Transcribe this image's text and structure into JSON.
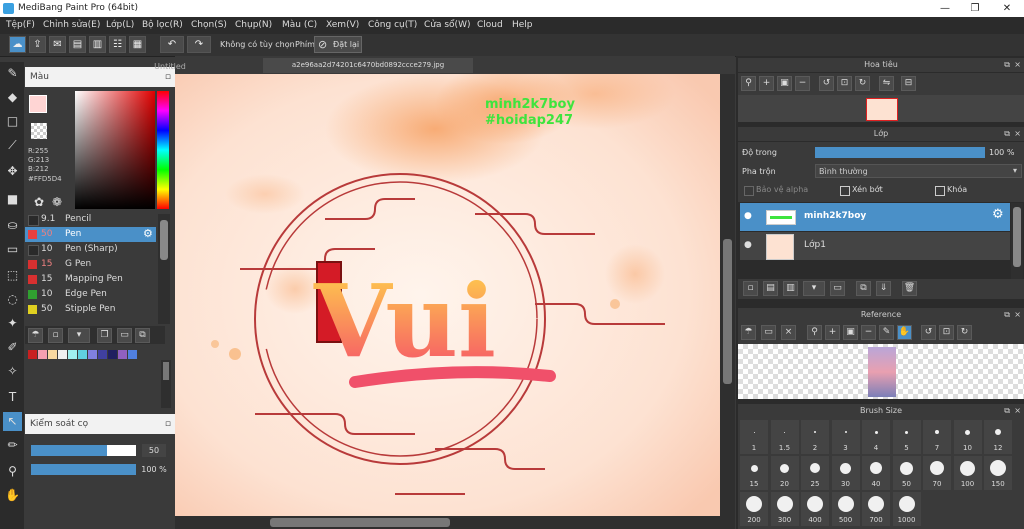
{
  "window": {
    "title": "MediBang Paint Pro (64bit)"
  },
  "menu": [
    "Tệp(F)",
    "Chỉnh sửa(E)",
    "Lớp(L)",
    "Bộ lọc(R)",
    "Chọn(S)",
    "Chụp(N)",
    "Màu (C)",
    "Xem(V)",
    "Công cụ(T)",
    "Cửa sổ(W)",
    "Cloud",
    "Help"
  ],
  "toolbar": {
    "no_option": "Không có tùy chọn",
    "key_label": "Phím",
    "reset_label": "Đặt lại"
  },
  "document": {
    "tab_untitled": "Untitled",
    "tab_active": "a2e96aa2d74201c6470bd0892ccce279.jpg"
  },
  "color_panel": {
    "title": "Màu",
    "r": "R:255",
    "g": "G:213",
    "b": "B:212",
    "hex": "#FFD5D4"
  },
  "brushes": [
    {
      "size": "9.1",
      "name": "Pencil",
      "color": "#2a2a2a"
    },
    {
      "size": "50",
      "name": "Pen",
      "color": "#e84040",
      "selected": true
    },
    {
      "size": "10",
      "name": "Pen (Sharp)",
      "color": "#2a2a2a"
    },
    {
      "size": "15",
      "name": "G Pen",
      "color": "#d83030"
    },
    {
      "size": "15",
      "name": "Mapping Pen",
      "color": "#d83030"
    },
    {
      "size": "10",
      "name": "Edge Pen",
      "color": "#30a030"
    },
    {
      "size": "50",
      "name": "Stipple Pen",
      "color": "#e0d020"
    }
  ],
  "palette": [
    "#c82020",
    "#f4a0b0",
    "#f8d8a0",
    "#f0f0f0",
    "#a0f0f0",
    "#60d0e0",
    "#8080e0",
    "#4040a0",
    "#202060",
    "#9060c0",
    "#5080e0"
  ],
  "control_panel": {
    "title": "Kiểm soát cọ",
    "size_value": "50",
    "opacity_value": "100 %",
    "size_fill": 0.72,
    "opacity_fill": 1.0
  },
  "canvas": {
    "watermark_line1": "minh2k7boy",
    "watermark_line2": "#hoidap247",
    "art_text": "Vui"
  },
  "navigator": {
    "title": "Hoa tiêu"
  },
  "layers": {
    "title": "Lớp",
    "opacity_label": "Độ trong",
    "opacity_value": "100 %",
    "blend_label": "Pha trộn",
    "blend_value": "Bình thường",
    "protect_alpha": "Bảo vệ alpha",
    "clipping": "Xén bớt",
    "lock": "Khóa",
    "items": [
      {
        "name": "minh2k7boy",
        "selected": true
      },
      {
        "name": "Lớp1",
        "selected": false
      }
    ]
  },
  "reference": {
    "title": "Reference"
  },
  "brush_size": {
    "title": "Brush Size",
    "row1": [
      "1",
      "1.5",
      "2",
      "3",
      "4",
      "5",
      "7",
      "10",
      "12"
    ],
    "row2": [
      "15",
      "20",
      "25",
      "30",
      "40",
      "50",
      "70",
      "100",
      "150"
    ],
    "row3": [
      "200",
      "300",
      "400",
      "500",
      "700",
      "1000"
    ]
  },
  "colors": {
    "accent": "#4a90c8",
    "panel": "#3a3a3a",
    "dark": "#2b2b2b",
    "selected_row": "#4a90c8"
  }
}
